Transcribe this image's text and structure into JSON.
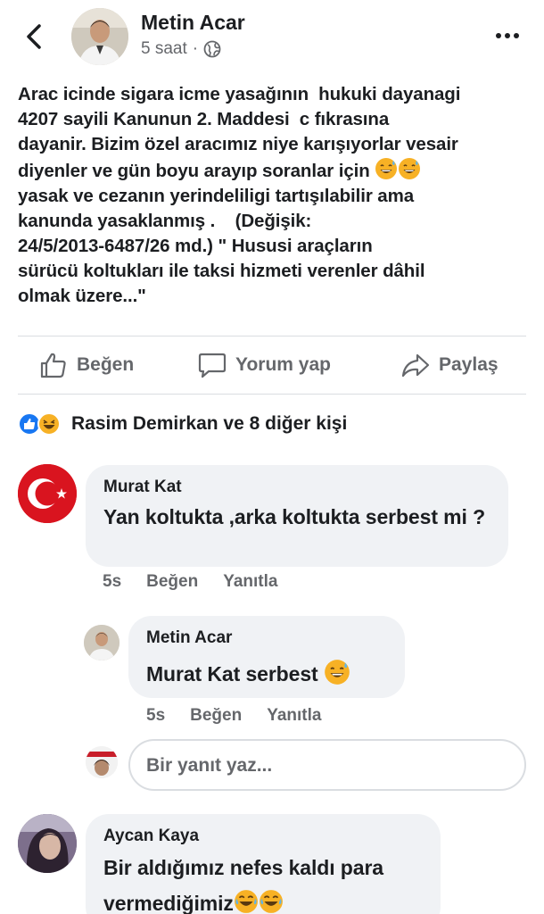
{
  "header": {
    "back_label": "",
    "author": "Metin Acar",
    "time": "5 saat",
    "separator": "·",
    "privacy_icon": "globe-icon",
    "more_icon": "more-horizontal-icon"
  },
  "post": {
    "text": "Arac icinde sigara icme yasağının  hukuki dayanagi\n4207 sayili Kanunun 2. Maddesi  c fıkrasına\ndayanir. Bizim özel aracımız niye karışıyorlar vesair\ndiyenler ve gün boyu arayıp soranlar için",
    "text_after_emoji": "yasak ve cezanın yerindeliligi tartışılabilir ama\nkanunda yasaklanmış .    (Değişik:\n24/5/2013-6487/26 md.) \" Hususi araçların\nsürücü koltukları ile taksi hizmeti verenler dâhil\nolmak üzere...\""
  },
  "actions": {
    "like": "Beğen",
    "comment": "Yorum yap",
    "share": "Paylaş"
  },
  "reactions": {
    "summary": "Rasim Demirkan ve 8 diğer kişi"
  },
  "comments": [
    {
      "author": "Murat Kat",
      "text": "Yan koltukta ,arka koltukta serbest mi ?",
      "time": "5s",
      "like": "Beğen",
      "reply": "Yanıtla"
    },
    {
      "author": "Metin Acar",
      "text": "Murat Kat serbest",
      "time": "5s",
      "like": "Beğen",
      "reply": "Yanıtla"
    },
    {
      "author": "Aycan Kaya",
      "text": "Bir aldığımız nefes kaldı para vermediğimiz"
    }
  ],
  "reply_box": {
    "placeholder": "Bir yanıt yaz..."
  },
  "colors": {
    "text": "#1c1e21",
    "secondary": "#65676b",
    "bubble": "#f0f2f5",
    "divider": "#dadde1",
    "like_blue": "#1877f2",
    "emoji_yellow": "#f7b125"
  }
}
